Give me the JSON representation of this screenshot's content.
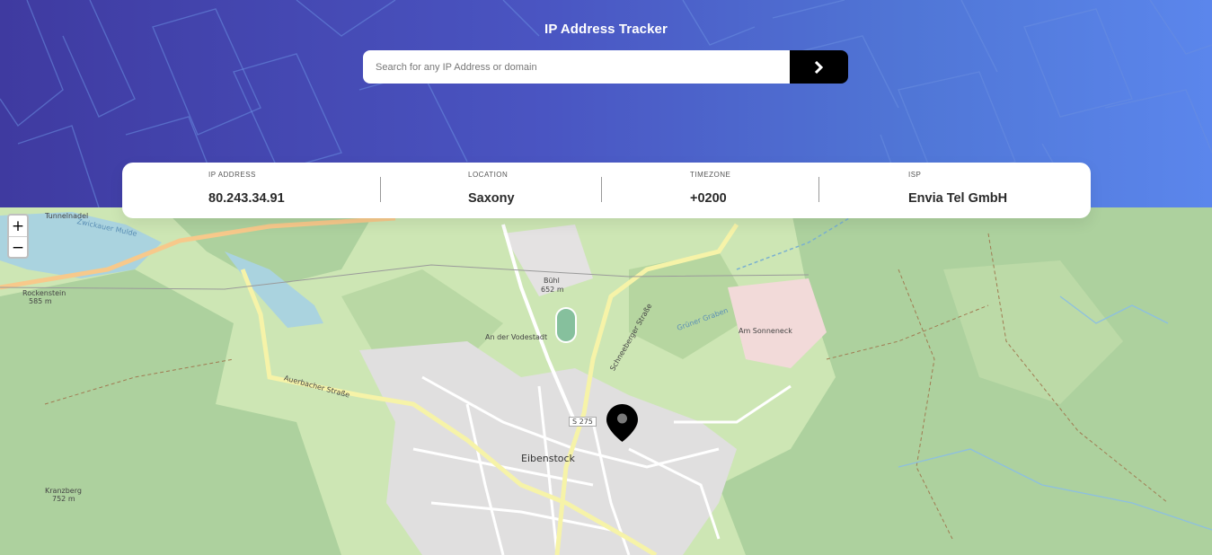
{
  "header": {
    "title": "IP Address Tracker",
    "search_placeholder": "Search for any IP Address or domain",
    "submit_icon": "chevron-right-icon"
  },
  "info": [
    {
      "label": "IP ADDRESS",
      "value": "80.243.34.91"
    },
    {
      "label": "LOCATION",
      "value": "Saxony"
    },
    {
      "label": "TIMEZONE",
      "value": "+0200"
    },
    {
      "label": "ISP",
      "value": "Envia Tel GmbH"
    }
  ],
  "map": {
    "zoom_in": "+",
    "zoom_out": "−",
    "marker_icon": "location-pin-icon",
    "labels": {
      "town": "Eibenstock",
      "road": "S 275",
      "buhl": "Bühl",
      "buhl_elev": "652 m",
      "rockenstein": "Rockenstein",
      "rockenstein_elev": "585 m",
      "kranzberg": "Kranzberg",
      "kranzberg_elev": "752 m",
      "sonneneck": "Am Sonneneck",
      "vodenstadt": "An der Vodestadt",
      "tunnel": "Tunnelnadel",
      "auerbacher": "Auerbacher Straße",
      "schneeberger": "Schneeberger Straße",
      "zwickauer": "Zwickauer Mulde",
      "gruner": "Grüner Graben"
    }
  },
  "colors": {
    "header_start": "#3f3aa0",
    "header_end": "#5b86ec",
    "button": "#000000",
    "map_green": "#cde6b4",
    "forest": "#add19e"
  }
}
